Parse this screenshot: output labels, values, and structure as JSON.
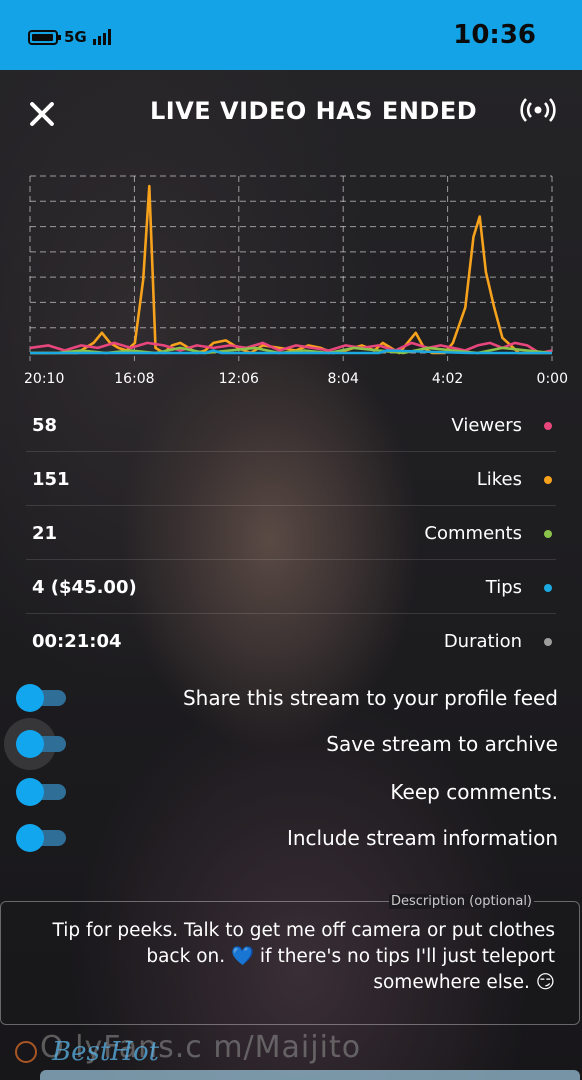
{
  "status_bar": {
    "time": "10:36",
    "network": "5G"
  },
  "header": {
    "title": "LIVE VIDEO HAS ENDED"
  },
  "chart_data": {
    "type": "line",
    "x_ticks": [
      "0:00",
      "4:02",
      "8:04",
      "12:06",
      "16:08",
      "20:10"
    ],
    "x_range_seconds": [
      0,
      1264
    ],
    "grid": true,
    "series": [
      {
        "color": "#f6a21c",
        "points": [
          [
            0,
            0
          ],
          [
            40,
            0
          ],
          [
            80,
            0
          ],
          [
            100,
            3
          ],
          [
            120,
            6
          ],
          [
            140,
            18
          ],
          [
            160,
            32
          ],
          [
            175,
            54
          ],
          [
            190,
            46
          ],
          [
            210,
            18
          ],
          [
            240,
            4
          ],
          [
            260,
            0
          ],
          [
            290,
            0
          ],
          [
            310,
            2
          ],
          [
            330,
            8
          ],
          [
            350,
            4
          ],
          [
            370,
            0
          ],
          [
            390,
            2
          ],
          [
            410,
            4
          ],
          [
            430,
            1
          ],
          [
            460,
            3
          ],
          [
            480,
            2
          ],
          [
            500,
            1
          ],
          [
            530,
            0
          ],
          [
            560,
            2
          ],
          [
            590,
            3
          ],
          [
            620,
            1
          ],
          [
            660,
            2
          ],
          [
            700,
            3
          ],
          [
            730,
            0
          ],
          [
            760,
            2
          ],
          [
            790,
            5
          ],
          [
            820,
            4
          ],
          [
            840,
            1
          ],
          [
            860,
            0
          ],
          [
            880,
            2
          ],
          [
            900,
            4
          ],
          [
            920,
            3
          ],
          [
            940,
            0
          ],
          [
            960,
            2
          ],
          [
            975,
            66
          ],
          [
            990,
            29
          ],
          [
            1010,
            4
          ],
          [
            1030,
            1
          ],
          [
            1050,
            2
          ],
          [
            1070,
            4
          ],
          [
            1090,
            8
          ],
          [
            1110,
            4
          ],
          [
            1130,
            2
          ],
          [
            1150,
            0
          ],
          [
            1264,
            0
          ]
        ]
      },
      {
        "color": "#e8467c",
        "points": [
          [
            0,
            1
          ],
          [
            30,
            0
          ],
          [
            60,
            3
          ],
          [
            90,
            4
          ],
          [
            120,
            2
          ],
          [
            150,
            4
          ],
          [
            180,
            3
          ],
          [
            210,
            1
          ],
          [
            240,
            2
          ],
          [
            270,
            3
          ],
          [
            300,
            2
          ],
          [
            340,
            4
          ],
          [
            380,
            1
          ],
          [
            420,
            3
          ],
          [
            460,
            2
          ],
          [
            500,
            3
          ],
          [
            540,
            1
          ],
          [
            580,
            2
          ],
          [
            620,
            3
          ],
          [
            660,
            1
          ],
          [
            700,
            4
          ],
          [
            740,
            2
          ],
          [
            780,
            3
          ],
          [
            820,
            2
          ],
          [
            860,
            3
          ],
          [
            900,
            1
          ],
          [
            940,
            3
          ],
          [
            980,
            4
          ],
          [
            1020,
            2
          ],
          [
            1060,
            4
          ],
          [
            1100,
            2
          ],
          [
            1140,
            3
          ],
          [
            1180,
            1
          ],
          [
            1220,
            3
          ],
          [
            1264,
            2
          ]
        ]
      },
      {
        "color": "#8bc34a",
        "points": [
          [
            0,
            0
          ],
          [
            60,
            1
          ],
          [
            120,
            2
          ],
          [
            180,
            0
          ],
          [
            240,
            1
          ],
          [
            300,
            2
          ],
          [
            360,
            0
          ],
          [
            420,
            1
          ],
          [
            480,
            2
          ],
          [
            540,
            0
          ],
          [
            600,
            1
          ],
          [
            660,
            0
          ],
          [
            720,
            2
          ],
          [
            780,
            1
          ],
          [
            840,
            0
          ],
          [
            900,
            2
          ],
          [
            960,
            0
          ],
          [
            1020,
            1
          ],
          [
            1080,
            0
          ],
          [
            1140,
            1
          ],
          [
            1200,
            0
          ],
          [
            1264,
            0
          ]
        ]
      },
      {
        "color": "#1aa9e0",
        "points": [
          [
            0,
            0
          ],
          [
            200,
            0
          ],
          [
            400,
            1
          ],
          [
            420,
            0
          ],
          [
            800,
            0
          ],
          [
            820,
            1
          ],
          [
            840,
            0
          ],
          [
            1264,
            0
          ]
        ]
      }
    ],
    "y_range": [
      0,
      70
    ]
  },
  "stats": [
    {
      "label": "Viewers",
      "value": "58",
      "dot_color": "#e8467c"
    },
    {
      "label": "Likes",
      "value": "151",
      "dot_color": "#f6a21c"
    },
    {
      "label": "Comments",
      "value": "21",
      "dot_color": "#8bc34a"
    },
    {
      "label": "Tips",
      "value": "4 ($45.00)",
      "dot_color": "#1aa9e0"
    },
    {
      "label": "Duration",
      "value": "00:21:04",
      "dot_color": "#9e9e9e"
    }
  ],
  "toggles": [
    {
      "label": "Share this stream to your profile feed",
      "on": true
    },
    {
      "label": "Save stream to archive",
      "on": true
    },
    {
      "label": "Keep comments.",
      "on": true
    },
    {
      "label": "Include stream information",
      "on": true
    }
  ],
  "description": {
    "legend": "Description (optional)",
    "text": "Tip for peeks. Talk to get me off camera or put clothes back on. 💙 if there's no tips I'll just teleport somewhere else. 😏"
  },
  "footer": {
    "url_text": "O lyFans.c m/Maijito"
  },
  "colors": {
    "accent": "#13a3e6"
  }
}
